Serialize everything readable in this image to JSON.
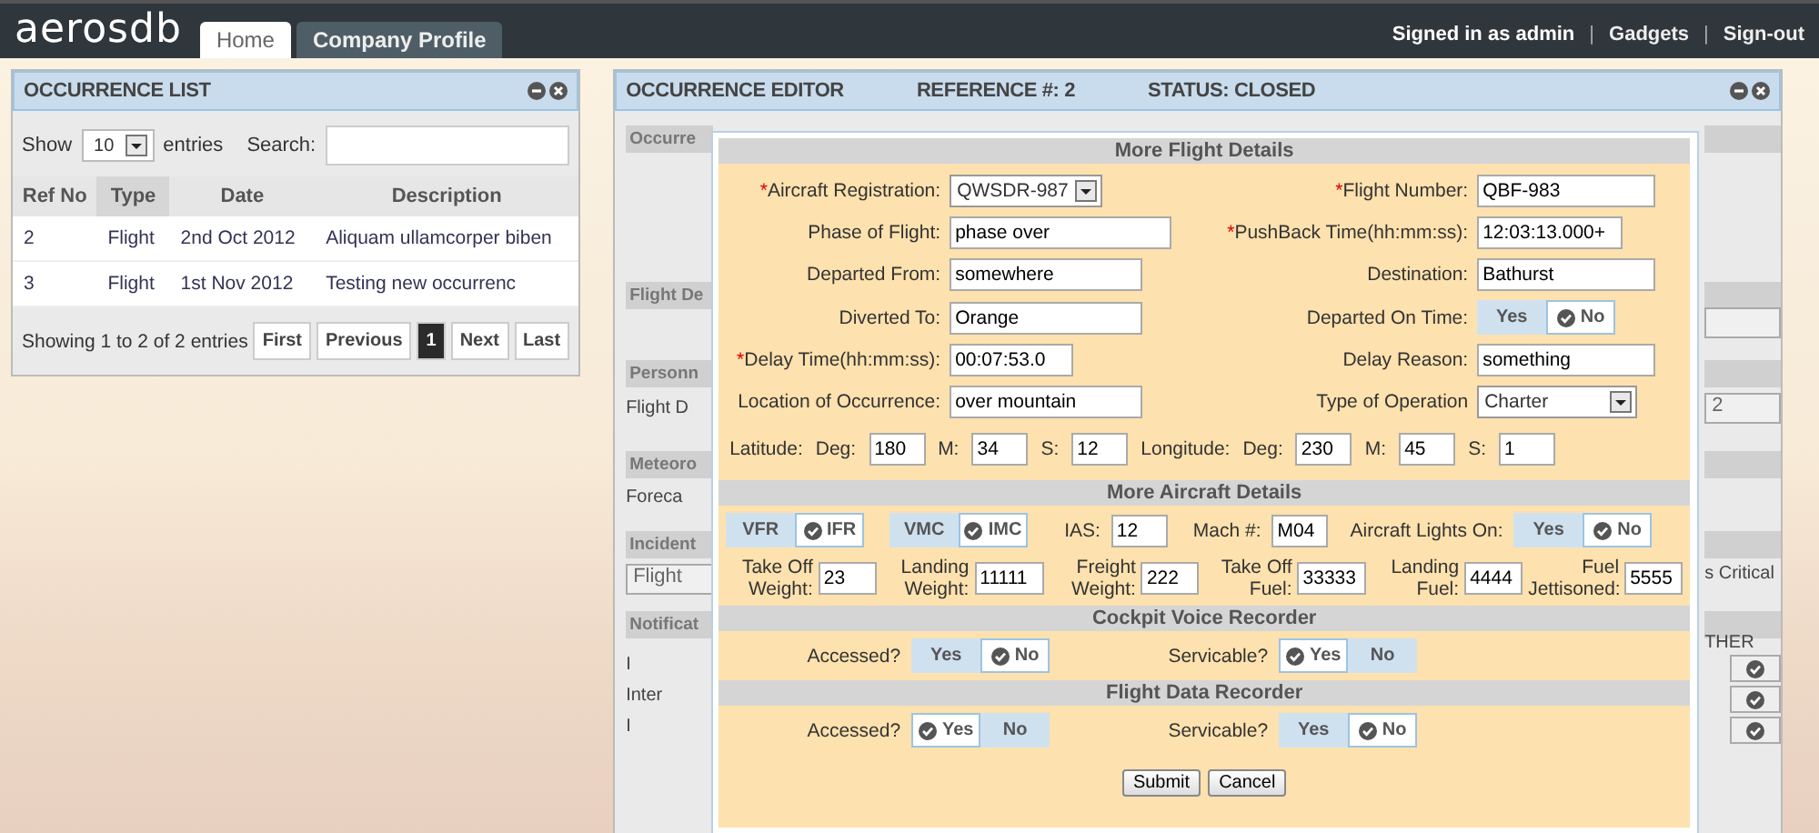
{
  "header": {
    "logo": "aerosdb",
    "tabs": [
      {
        "label": "Home",
        "selected": true
      },
      {
        "label": "Company Profile",
        "selected": false
      }
    ],
    "user": "Signed in as admin",
    "separator": "|",
    "links": [
      "Gadgets",
      "Sign-out"
    ]
  },
  "occurrence_list": {
    "title": "OCCURRENCE LIST",
    "show_label": "Show",
    "page_size": "10",
    "entries_label": "entries",
    "search_label": "Search:",
    "columns": [
      {
        "label": "Ref No",
        "sorted": false
      },
      {
        "label": "Type",
        "sorted": true
      },
      {
        "label": "Date",
        "sorted": false
      },
      {
        "label": "Description",
        "sorted": false
      }
    ],
    "rows": [
      [
        "2",
        "Flight",
        "2nd Oct 2012",
        "Aliquam ullamcorper biben"
      ],
      [
        "3",
        "Flight",
        "1st Nov 2012",
        "Testing new occurrenc"
      ]
    ],
    "info": "Showing 1 to 2 of 2 entries",
    "pager": [
      {
        "label": "First",
        "selected": false
      },
      {
        "label": "Previous",
        "selected": false
      },
      {
        "label": "1",
        "selected": true
      },
      {
        "label": "Next",
        "selected": false
      },
      {
        "label": "Last",
        "selected": false
      }
    ]
  },
  "occurrence_editor": {
    "title": "OCCURRENCE EDITOR",
    "reference": "REFERENCE #: 2",
    "status": "STATUS: CLOSED",
    "left_behind": [
      {
        "kind": "header",
        "text": "Occurre"
      },
      {
        "kind": "header",
        "text": "Flight De"
      },
      {
        "kind": "header",
        "text": "Personn"
      },
      {
        "kind": "text",
        "text": "Flight D"
      },
      {
        "kind": "header",
        "text": "Meteoro"
      },
      {
        "kind": "text",
        "text": "Foreca"
      },
      {
        "kind": "header",
        "text": "Incident"
      },
      {
        "kind": "select",
        "text": "Flight"
      },
      {
        "kind": "header",
        "text": "Notificat"
      },
      {
        "kind": "text",
        "text": "I"
      },
      {
        "kind": "text",
        "text": "Inter"
      },
      {
        "kind": "text",
        "text": "I"
      }
    ],
    "right_behind": [
      {
        "kind": "header"
      },
      {
        "kind": "header"
      },
      {
        "kind": "input"
      },
      {
        "kind": "header"
      },
      {
        "kind": "input",
        "text": "2"
      },
      {
        "kind": "header"
      },
      {
        "kind": "header"
      },
      {
        "kind": "text",
        "text": "s Critical"
      },
      {
        "kind": "header"
      },
      {
        "kind": "text",
        "text": "THER"
      },
      {
        "kind": "check"
      },
      {
        "kind": "check"
      },
      {
        "kind": "check"
      }
    ]
  },
  "dialog": {
    "flight_title": "More Flight Details",
    "required_mark": "*",
    "flight_fields": [
      {
        "label": "Aircraft Registration:",
        "required": true,
        "kind": "select",
        "value": "QWSDR-987"
      },
      {
        "label": "Flight Number:",
        "required": true,
        "kind": "input",
        "value": "QBF-983"
      },
      {
        "label": "Phase of Flight:",
        "required": false,
        "kind": "input",
        "value": "phase over"
      },
      {
        "label": "PushBack Time(hh:mm:ss):",
        "required": true,
        "kind": "input",
        "value": "12:03:13.000+"
      },
      {
        "label": "Departed From:",
        "required": false,
        "kind": "input",
        "value": "somewhere"
      },
      {
        "label": "Destination:",
        "required": false,
        "kind": "input",
        "value": "Bathurst"
      },
      {
        "label": "Diverted To:",
        "required": false,
        "kind": "input",
        "value": "Orange"
      },
      {
        "label": "Departed On Time:",
        "required": false,
        "kind": "toggle",
        "options": [
          {
            "label": "Yes",
            "selected": false
          },
          {
            "label": "No",
            "selected": true
          }
        ]
      },
      {
        "label": "Delay Time(hh:mm:ss):",
        "required": true,
        "kind": "input",
        "value": "00:07:53.0"
      },
      {
        "label": "Delay Reason:",
        "required": false,
        "kind": "input",
        "value": "something"
      },
      {
        "label": "Location of Occurrence:",
        "required": false,
        "kind": "input",
        "value": "over mountain"
      },
      {
        "label": "Type of Operation",
        "required": false,
        "kind": "select",
        "value": "Charter"
      }
    ],
    "coordinates": [
      {
        "label": "Latitude:",
        "parts": [
          {
            "label": "Deg:",
            "value": "180"
          },
          {
            "label": "M:",
            "value": "34"
          },
          {
            "label": "S:",
            "value": "12"
          }
        ]
      },
      {
        "label": "Longitude:",
        "parts": [
          {
            "label": "Deg:",
            "value": "230"
          },
          {
            "label": "M:",
            "value": "45"
          },
          {
            "label": "S:",
            "value": "1"
          }
        ]
      }
    ],
    "aircraft_title": "More Aircraft Details",
    "aircraft_items": [
      {
        "kind": "toggle",
        "options": [
          {
            "label": "VFR",
            "selected": false
          },
          {
            "label": "IFR",
            "selected": true
          }
        ]
      },
      {
        "kind": "toggle",
        "options": [
          {
            "label": "VMC",
            "selected": false
          },
          {
            "label": "IMC",
            "selected": true
          }
        ]
      },
      {
        "kind": "input",
        "label": "IAS:",
        "value": "12"
      },
      {
        "kind": "input",
        "label": "Mach #:",
        "value": "M04"
      },
      {
        "kind": "toggle",
        "label": "Aircraft Lights On:",
        "options": [
          {
            "label": "Yes",
            "selected": false
          },
          {
            "label": "No",
            "selected": true
          }
        ]
      }
    ],
    "weights": [
      {
        "label": "Take Off Weight:",
        "value": "23"
      },
      {
        "label": "Landing Weight:",
        "value": "11111"
      },
      {
        "label": "Freight Weight:",
        "value": "222"
      },
      {
        "label": "Take Off Fuel:",
        "value": "33333"
      },
      {
        "label": "Landing Fuel:",
        "value": "4444"
      },
      {
        "label": "Fuel Jettisoned:",
        "value": "5555"
      }
    ],
    "recorders": [
      {
        "title": "Cockpit Voice Recorder",
        "items": [
          {
            "label": "Accessed?",
            "options": [
              {
                "label": "Yes",
                "selected": false
              },
              {
                "label": "No",
                "selected": true
              }
            ]
          },
          {
            "label": "Servicable?",
            "options": [
              {
                "label": "Yes",
                "selected": true
              },
              {
                "label": "No",
                "selected": false
              }
            ]
          }
        ]
      },
      {
        "title": "Flight Data Recorder",
        "items": [
          {
            "label": "Accessed?",
            "options": [
              {
                "label": "Yes",
                "selected": true
              },
              {
                "label": "No",
                "selected": false
              }
            ]
          },
          {
            "label": "Servicable?",
            "options": [
              {
                "label": "Yes",
                "selected": false
              },
              {
                "label": "No",
                "selected": true
              }
            ]
          }
        ]
      }
    ],
    "buttons": [
      "Submit",
      "Cancel"
    ]
  }
}
